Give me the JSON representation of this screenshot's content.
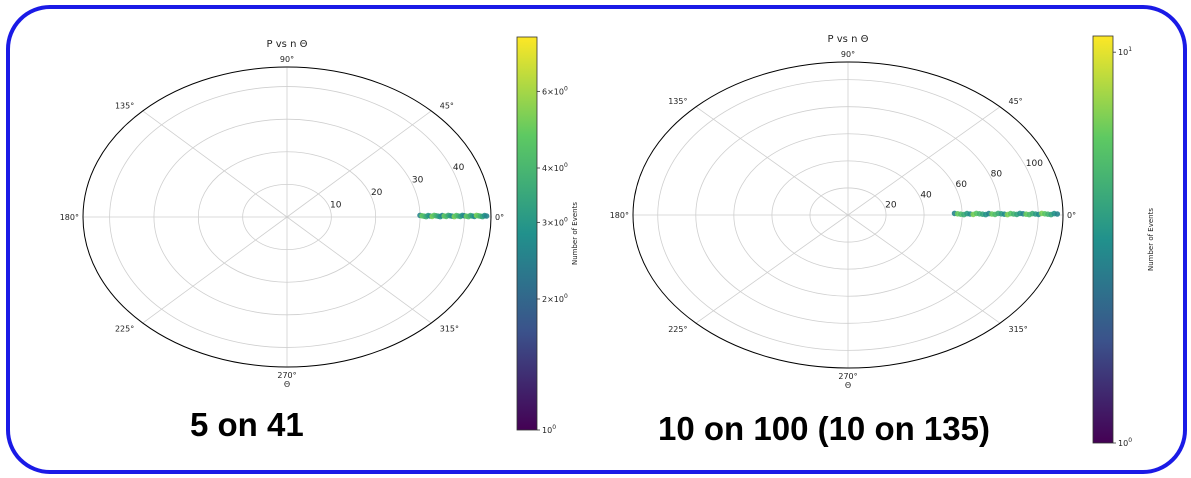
{
  "chart_data": [
    {
      "type": "scatter",
      "projection": "polar",
      "title": "P vs n Θ",
      "xlabel": "Θ",
      "angle_ticks": [
        "0°",
        "45°",
        "90°",
        "135°",
        "180°",
        "225°",
        "270°",
        "315°"
      ],
      "r_ticks": [
        10,
        20,
        30,
        40
      ],
      "r_tick_labels": [
        "10",
        "20",
        "30",
        "40"
      ],
      "rlim": [
        0,
        46
      ],
      "grid": true,
      "points": {
        "theta_deg": 0,
        "r_range": [
          30,
          45
        ]
      },
      "colorbar": {
        "label": "Number of Events",
        "scale": "log",
        "range": [
          1,
          8
        ],
        "colormap": "viridis",
        "tick_labels": [
          "10^0",
          "2×10^0",
          "3×10^0",
          "4×10^0",
          "6×10^0"
        ],
        "tick_values": [
          1,
          2,
          3,
          4,
          6
        ]
      },
      "caption": "5 on 41"
    },
    {
      "type": "scatter",
      "projection": "polar",
      "title": "P vs n Θ",
      "xlabel": "Θ",
      "angle_ticks": [
        "0°",
        "45°",
        "90°",
        "135°",
        "180°",
        "225°",
        "270°",
        "315°"
      ],
      "r_ticks": [
        20,
        40,
        60,
        80,
        100
      ],
      "r_tick_labels": [
        "20",
        "40",
        "60",
        "80",
        "100"
      ],
      "rlim": [
        0,
        113
      ],
      "grid": true,
      "points": {
        "theta_deg": 0,
        "r_range": [
          56,
          110
        ]
      },
      "colorbar": {
        "label": "Number of Events",
        "scale": "log",
        "range": [
          1,
          11
        ],
        "colormap": "viridis",
        "tick_labels": [
          "10^0",
          "10^1"
        ],
        "tick_values": [
          1,
          10
        ]
      },
      "caption": "10 on 100 (10 on 135)"
    }
  ],
  "colors": {
    "frame_border": "#1a1ae6",
    "viridis": [
      "#440154",
      "#3b528b",
      "#21918c",
      "#5ec962",
      "#fde725"
    ]
  }
}
